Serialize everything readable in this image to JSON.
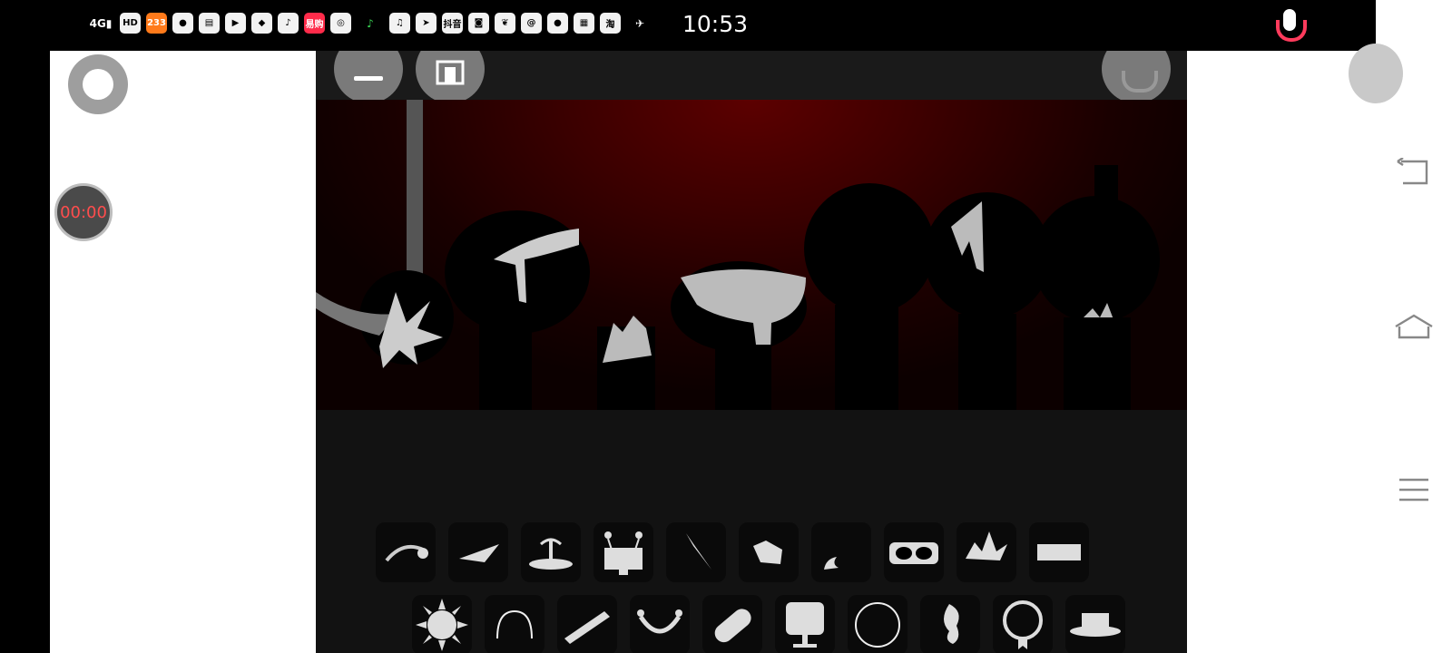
{
  "status_bar": {
    "network": "4G",
    "hd": "HD",
    "app_badges": [
      "233",
      "易购",
      "抖音"
    ],
    "time": "10:53"
  },
  "overlay": {
    "timer": "00:00"
  },
  "game": {
    "palette_row1": [
      "tool-curve",
      "tool-wedge",
      "tool-palm",
      "tool-robot",
      "tool-blade",
      "tool-blob",
      "tool-drop",
      "tool-mask",
      "tool-crown",
      "tool-bar"
    ],
    "palette_row2": [
      "tool-sun",
      "tool-arc",
      "tool-band",
      "tool-horns",
      "tool-capsule",
      "tool-monitor",
      "tool-ring",
      "tool-hook",
      "tool-medal",
      "tool-hat"
    ]
  },
  "colors": {
    "stage_red": "#5c0000",
    "mic_accent": "#ff3b5c",
    "timer_text": "#ff4d4d"
  }
}
